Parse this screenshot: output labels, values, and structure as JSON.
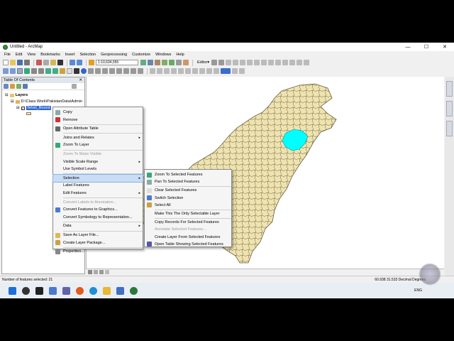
{
  "window": {
    "title": "Untitled - ArcMap",
    "controls": [
      "—",
      "☐",
      "✕"
    ]
  },
  "menubar": [
    "File",
    "Edit",
    "View",
    "Bookmarks",
    "Insert",
    "Selection",
    "Geoprocessing",
    "Customize",
    "Windows",
    "Help"
  ],
  "toolbar": {
    "scale": "1:10,634,555",
    "editor_label": "Editor▾"
  },
  "toc": {
    "title": "Table Of Contents",
    "root": "Layers",
    "path": "D:\\Class Work\\PakistanData\\Admin",
    "layer": "Tehsil_Bound",
    "swatch_color": "#efe4b0"
  },
  "map": {
    "fill_color": "#efe4b0",
    "border_color": "#6d6044",
    "selected_color": "#00ffff"
  },
  "context_menu": {
    "items": [
      {
        "label": "Copy",
        "icon": "copy-icon",
        "state": "normal"
      },
      {
        "label": "Remove",
        "icon": "remove-icon",
        "state": "normal"
      },
      {
        "label": "Open Attribute Table",
        "icon": "table-icon",
        "state": "normal"
      },
      {
        "label": "Joins and Relates",
        "icon": "",
        "state": "normal",
        "submenu": true
      },
      {
        "label": "Zoom To Layer",
        "icon": "zoom-layer-icon",
        "state": "normal"
      },
      {
        "label": "Zoom To Make Visible",
        "icon": "",
        "state": "disabled"
      },
      {
        "label": "Visible Scale Range",
        "icon": "",
        "state": "normal",
        "submenu": true
      },
      {
        "label": "Use Symbol Levels",
        "icon": "",
        "state": "normal"
      },
      {
        "label": "Selection",
        "icon": "",
        "state": "highlight",
        "submenu": true
      },
      {
        "label": "Label Features",
        "icon": "",
        "state": "normal"
      },
      {
        "label": "Edit Features",
        "icon": "",
        "state": "normal",
        "submenu": true
      },
      {
        "label": "Convert Labels to Annotation...",
        "icon": "",
        "state": "disabled"
      },
      {
        "label": "Convert Features to Graphics...",
        "icon": "convert-icon",
        "state": "normal"
      },
      {
        "label": "Convert Symbology to Representation...",
        "icon": "",
        "state": "normal"
      },
      {
        "label": "Data",
        "icon": "",
        "state": "normal",
        "submenu": true
      },
      {
        "label": "Save As Layer File...",
        "icon": "save-layer-icon",
        "state": "normal"
      },
      {
        "label": "Create Layer Package...",
        "icon": "package-icon",
        "state": "normal"
      },
      {
        "label": "Properties...",
        "icon": "properties-icon",
        "state": "normal"
      }
    ]
  },
  "selection_submenu": {
    "items": [
      {
        "label": "Zoom To Selected Features",
        "icon": "zoom-selected-icon",
        "state": "normal"
      },
      {
        "label": "Pan To Selected Features",
        "icon": "pan-icon",
        "state": "normal"
      },
      {
        "label": "Clear Selected Features",
        "icon": "clear-selection-icon",
        "state": "normal"
      },
      {
        "label": "Switch Selection",
        "icon": "switch-selection-icon",
        "state": "normal"
      },
      {
        "label": "Select All",
        "icon": "select-all-icon",
        "state": "normal"
      },
      {
        "label": "Make This The Only Selectable Layer",
        "icon": "",
        "state": "normal"
      },
      {
        "label": "Copy Records For Selected Features",
        "icon": "",
        "state": "normal"
      },
      {
        "label": "Annotate Selected Features...",
        "icon": "",
        "state": "disabled"
      },
      {
        "label": "Create Layer From Selected Features",
        "icon": "",
        "state": "normal"
      },
      {
        "label": "Open Table Showing Selected Features",
        "icon": "table-selected-icon",
        "state": "normal"
      }
    ]
  },
  "status": {
    "left": "Number of features selected: 21",
    "right": "60.938  31.533 Decimal Degrees"
  },
  "taskbar": {
    "lang": "ENG"
  }
}
